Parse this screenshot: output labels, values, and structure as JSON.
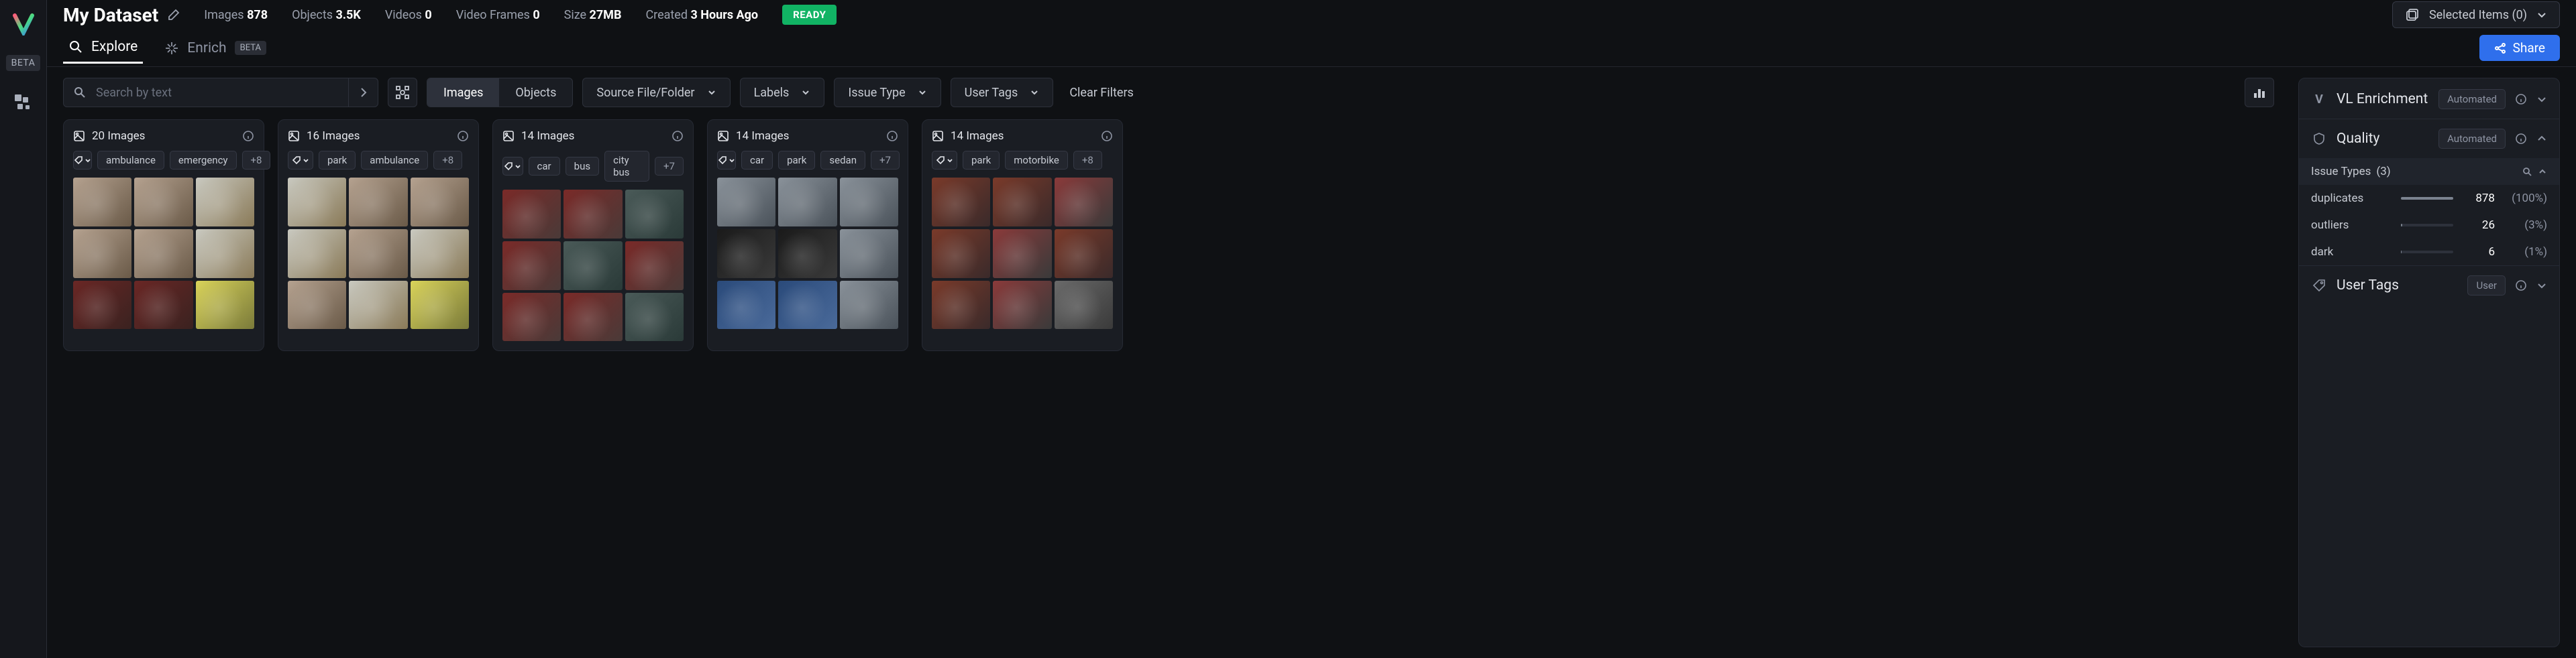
{
  "leftbar": {
    "beta": "BETA"
  },
  "header": {
    "title": "My Dataset",
    "stats": {
      "images_label": "Images",
      "images_value": "878",
      "objects_label": "Objects",
      "objects_value": "3.5K",
      "videos_label": "Videos",
      "videos_value": "0",
      "frames_label": "Video Frames",
      "frames_value": "0",
      "size_label": "Size",
      "size_value": "27MB",
      "created_label": "Created",
      "created_value": "3 Hours Ago"
    },
    "ready": "READY",
    "selected": "Selected Items (0)"
  },
  "tabs": {
    "explore": "Explore",
    "enrich": "Enrich",
    "enrich_beta": "BETA",
    "share": "Share"
  },
  "filters": {
    "search_placeholder": "Search by text",
    "images": "Images",
    "objects": "Objects",
    "source": "Source File/Folder",
    "labels": "Labels",
    "issue_type": "Issue Type",
    "user_tags": "User Tags",
    "clear": "Clear Filters"
  },
  "clusters": [
    {
      "count": "20 Images",
      "tags": [
        "ambulance",
        "emergency"
      ],
      "more": "+8",
      "style": "amb"
    },
    {
      "count": "16 Images",
      "tags": [
        "park",
        "ambulance"
      ],
      "more": "+8",
      "style": "amb2"
    },
    {
      "count": "14 Images",
      "tags": [
        "car",
        "bus",
        "city bus"
      ],
      "more": "+7",
      "style": "bus"
    },
    {
      "count": "14 Images",
      "tags": [
        "car",
        "park",
        "sedan"
      ],
      "more": "+7",
      "style": "car"
    },
    {
      "count": "14 Images",
      "tags": [
        "park",
        "motorbike"
      ],
      "more": "+8",
      "style": "bike"
    }
  ],
  "side": {
    "enrichment": {
      "title": "VL Enrichment",
      "badge": "Automated"
    },
    "quality": {
      "title": "Quality",
      "badge": "Automated"
    },
    "issue_types": {
      "label": "Issue Types",
      "count": "(3)"
    },
    "issues": [
      {
        "name": "duplicates",
        "count": "878",
        "pct": "(100%)",
        "fill": 100
      },
      {
        "name": "outliers",
        "count": "26",
        "pct": "(3%)",
        "fill": 3
      },
      {
        "name": "dark",
        "count": "6",
        "pct": "(1%)",
        "fill": 1
      }
    ],
    "user_tags": {
      "title": "User Tags",
      "badge": "User"
    }
  }
}
